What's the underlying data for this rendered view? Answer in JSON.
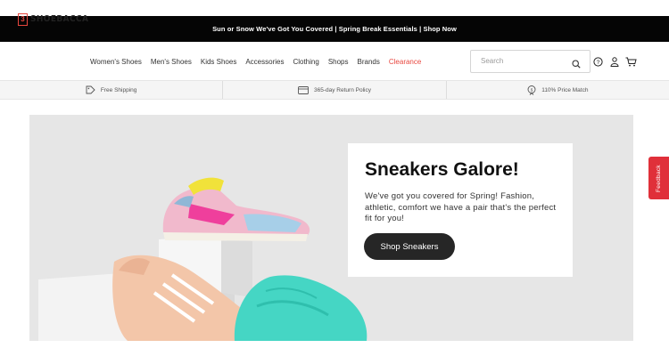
{
  "promo": {
    "text": "Sun or Snow We've Got You Covered | Spring Break Essentials | Shop Now"
  },
  "header": {
    "logo_mark": "3",
    "logo_text": "SHOEBACCA",
    "nav": [
      {
        "label": "Women's Shoes"
      },
      {
        "label": "Men's Shoes"
      },
      {
        "label": "Kids Shoes"
      },
      {
        "label": "Accessories"
      },
      {
        "label": "Clothing"
      },
      {
        "label": "Shops"
      },
      {
        "label": "Brands"
      },
      {
        "label": "Clearance",
        "color": "#e8473f"
      }
    ],
    "search_placeholder": "Search",
    "icons": [
      "search-icon",
      "help-icon",
      "account-icon",
      "cart-icon"
    ]
  },
  "benefits": [
    {
      "icon": "shipping-tag-icon",
      "label": "Free Shipping"
    },
    {
      "icon": "return-card-icon",
      "label": "365-day Return Policy"
    },
    {
      "icon": "price-tag-icon",
      "label": "110% Price Match"
    }
  ],
  "hero": {
    "title": "Sneakers Galore!",
    "text": "We've got you covered for Spring! Fashion, athletic, comfort we have a pair that's the perfect fit for you!",
    "button": "Shop Sneakers"
  },
  "feedback": {
    "label": "Feedback"
  },
  "colors": {
    "accent": "#e8473f",
    "feedback": "#e0303a",
    "promo_bg": "#050505",
    "hero_bg": "#e6e6e6"
  }
}
